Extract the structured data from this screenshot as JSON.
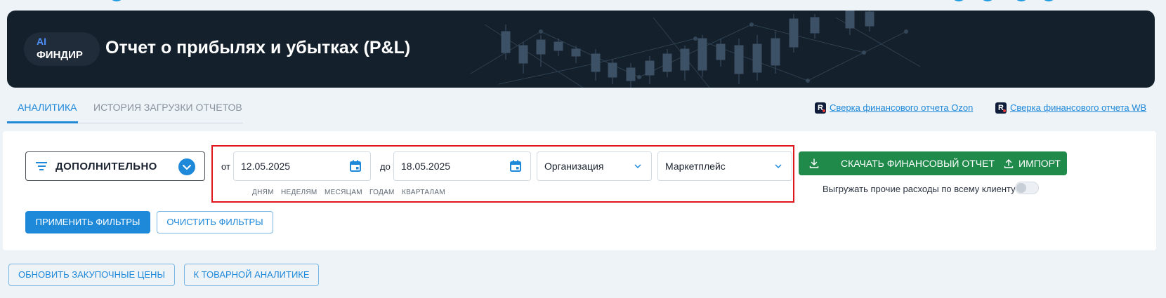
{
  "header": {
    "badge_top": "AI",
    "badge_bottom": "ФИНДИР",
    "title": "Отчет о прибылях и убытках (P&L)"
  },
  "tabs": [
    {
      "label": "АНАЛИТИКА",
      "active": true
    },
    {
      "label": "ИСТОРИЯ ЗАГРУЗКИ ОТЧЕТОВ",
      "active": false
    }
  ],
  "links": {
    "ozon": "Сверка финансового отчета Ozon",
    "wb": "Сверка финансового отчета WB",
    "icon_letter": "R"
  },
  "filters": {
    "additional_label": "ДОПОЛНИТЕЛЬНО",
    "from_label": "от",
    "to_label": "до",
    "date_from": "12.05.2025",
    "date_to": "18.05.2025",
    "organization_placeholder": "Организация",
    "marketplace_placeholder": "Маркетплейс",
    "granularity": [
      "ДНЯМ",
      "НЕДЕЛЯМ",
      "МЕСЯЦАМ",
      "ГОДАМ",
      "КВАРТАЛАМ"
    ]
  },
  "actions": {
    "download_label": "СКАЧАТЬ ФИНАНСОВЫЙ ОТЧЕТ",
    "import_label": "ИМПОРТ",
    "toggle_label": "Выгружать прочие расходы по всему клиенту",
    "toggle_on": false,
    "apply_label": "ПРИМЕНИТЬ ФИЛЬТРЫ",
    "clear_label": "ОЧИСТИТЬ ФИЛЬТРЫ",
    "update_prices_label": "ОБНОВИТЬ ЗАКУПОЧНЫЕ ЦЕНЫ",
    "product_analytics_label": "К ТОВАРНОЙ АНАЛИТИКЕ"
  },
  "colors": {
    "accent": "#1e88d9",
    "download": "#1f8a4a",
    "header_bg": "#14202b",
    "highlight": "#e0161e"
  }
}
